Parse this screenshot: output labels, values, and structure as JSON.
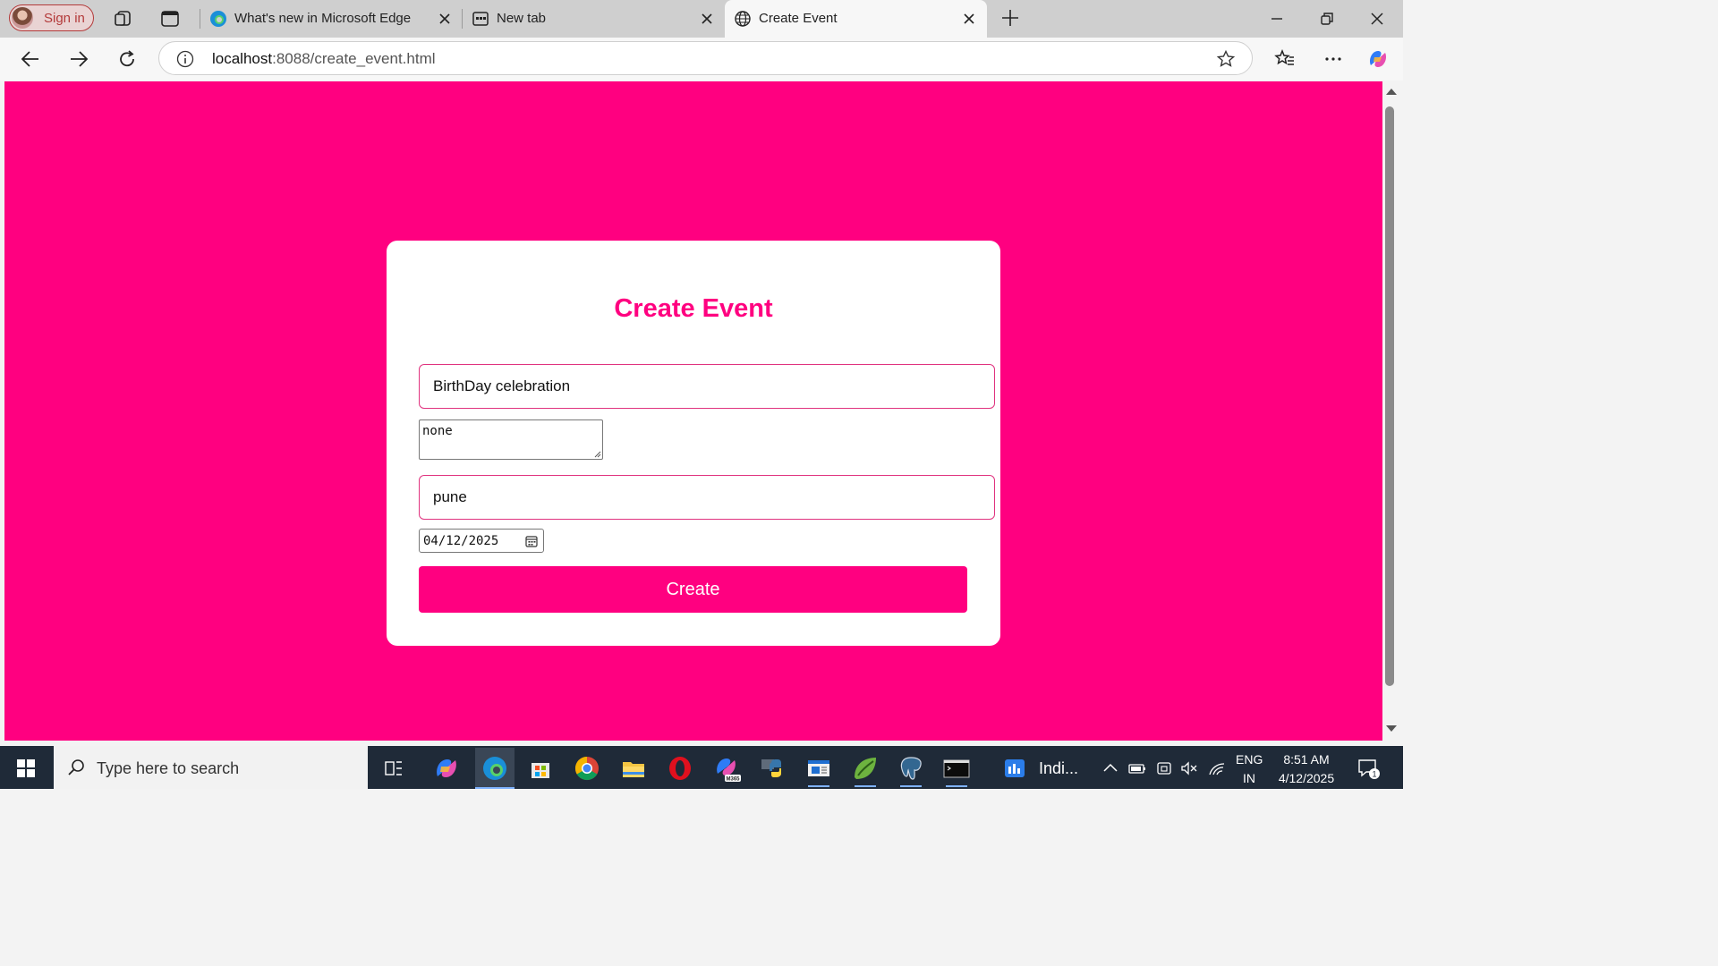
{
  "browser": {
    "sign_in_label": "Sign in",
    "tabs": [
      {
        "title": "What's new in Microsoft Edge",
        "icon": "edge-icon"
      },
      {
        "title": "New tab",
        "icon": "new-tab-page-icon"
      },
      {
        "title": "Create Event",
        "icon": "globe-icon",
        "active": true
      }
    ],
    "url_host": "localhost",
    "url_path": ":8088/create_event.html"
  },
  "page": {
    "background_color": "#ff0080",
    "heading": "Create Event",
    "event_name_value": "BirthDay celebration",
    "description_value": "none",
    "location_value": "pune",
    "date_value": "04/12/2025",
    "create_button_label": "Create"
  },
  "taskbar": {
    "search_placeholder": "Type here to search",
    "pinned_label": "Indi...",
    "language_line1": "ENG",
    "language_line2": "IN",
    "time": "8:51 AM",
    "date": "4/12/2025",
    "notification_count": "1"
  }
}
